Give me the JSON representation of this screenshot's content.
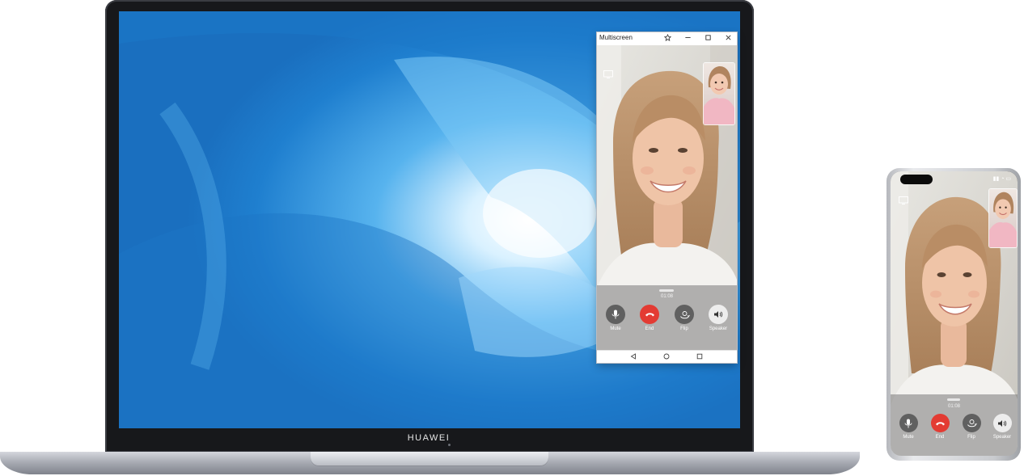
{
  "laptop": {
    "brand": "HUAWEI"
  },
  "window": {
    "title": "Multiscreen",
    "pin_icon": "pin-icon",
    "minimize_icon": "minimize-icon",
    "maximize_icon": "maximize-icon",
    "close_icon": "close-icon"
  },
  "call": {
    "timer": "01:08",
    "controls": [
      {
        "label": "Mute",
        "icon": "microphone-icon"
      },
      {
        "label": "End",
        "icon": "hang-up-icon"
      },
      {
        "label": "Flip",
        "icon": "camera-flip-icon"
      },
      {
        "label": "Speaker",
        "icon": "speaker-icon"
      }
    ]
  },
  "navbar": {
    "back_icon": "back-triangle-icon",
    "home_icon": "home-circle-icon",
    "recents_icon": "recents-square-icon"
  },
  "colors": {
    "end_button": "#e33b33",
    "wallpaper_blue": "#2b86d0"
  }
}
